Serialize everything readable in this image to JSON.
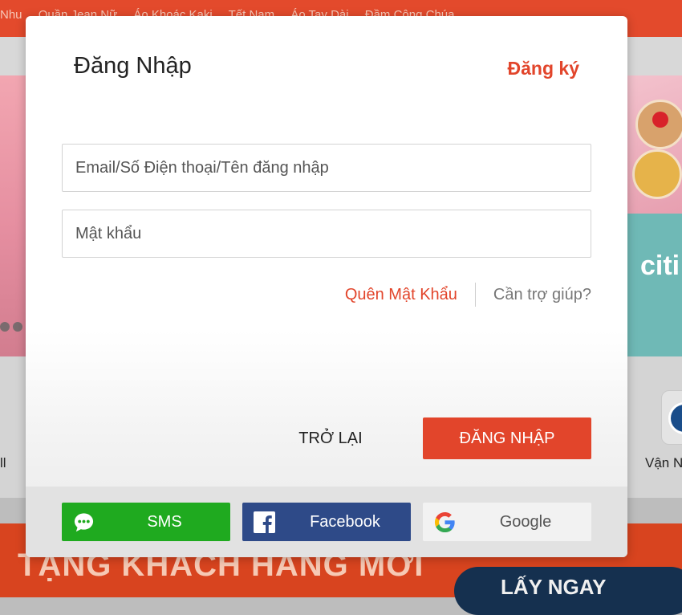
{
  "background": {
    "nav_items": [
      "Nhu",
      "Quần Jean Nữ",
      "Áo Khoác Kaki",
      "Tết Nam",
      "Áo Tay Dài",
      "Đầm Công Chúa"
    ],
    "left_tile_label": "ll",
    "right_tile_label": "Vận N",
    "citi_text": "citi",
    "promo_text": "TẶNG KHÁCH HÀNG MỚI",
    "promo_button": "LẤY NGAY"
  },
  "login_modal": {
    "title": "Đăng Nhập",
    "register_link": "Đăng ký",
    "username_placeholder": "Email/Số Điện thoại/Tên đăng nhập",
    "password_placeholder": "Mật khẩu",
    "forgot_password": "Quên Mật Khẩu",
    "help": "Cần trợ giúp?",
    "back_button": "TRỞ LẠI",
    "login_button": "ĐĂNG NHẬP",
    "social": {
      "sms": {
        "label": "SMS",
        "icon": "chat-bubble-icon",
        "color": "#1faa1f"
      },
      "facebook": {
        "label": "Facebook",
        "icon": "facebook-icon",
        "color": "#2e4a88"
      },
      "google": {
        "label": "Google",
        "icon": "google-icon",
        "color": "#f2f2f2"
      }
    },
    "accent_color": "#e2452b"
  }
}
